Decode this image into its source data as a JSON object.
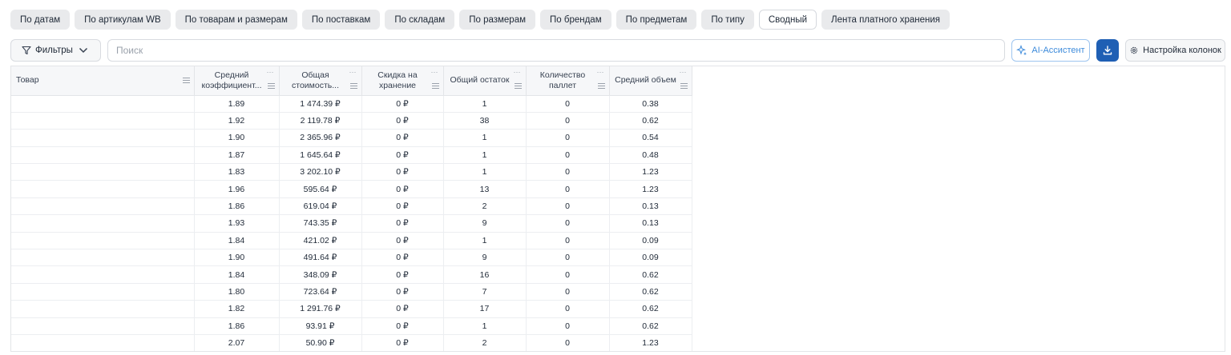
{
  "tabs": [
    {
      "label": "По датам",
      "active": false
    },
    {
      "label": "По артикулам WB",
      "active": false
    },
    {
      "label": "По товарам и размерам",
      "active": false
    },
    {
      "label": "По поставкам",
      "active": false
    },
    {
      "label": "По складам",
      "active": false
    },
    {
      "label": "По размерам",
      "active": false
    },
    {
      "label": "По брендам",
      "active": false
    },
    {
      "label": "По предметам",
      "active": false
    },
    {
      "label": "По типу",
      "active": false
    },
    {
      "label": "Сводный",
      "active": true
    },
    {
      "label": "Лента платного хранения",
      "active": false
    }
  ],
  "toolbar": {
    "filters_label": "Фильтры",
    "search_placeholder": "Поиск",
    "ai_label": "AI-Ассистент",
    "columns_label": "Настройка колонок"
  },
  "table": {
    "columns": [
      {
        "label": "Товар",
        "dots": ""
      },
      {
        "label": "Средний коэффициент...",
        "dots": "···"
      },
      {
        "label": "Общая стоимость...",
        "dots": "···"
      },
      {
        "label": "Скидка на хранение",
        "dots": "···"
      },
      {
        "label": "Общий остаток",
        "dots": "···"
      },
      {
        "label": "Количество паллет",
        "dots": "···"
      },
      {
        "label": "Средний объем",
        "dots": "···"
      }
    ],
    "rows": [
      [
        "",
        "1.89",
        "1 474.39 ₽",
        "0 ₽",
        "1",
        "0",
        "0.38"
      ],
      [
        "",
        "1.92",
        "2 119.78 ₽",
        "0 ₽",
        "38",
        "0",
        "0.62"
      ],
      [
        "",
        "1.90",
        "2 365.96 ₽",
        "0 ₽",
        "1",
        "0",
        "0.54"
      ],
      [
        "",
        "1.87",
        "1 645.64 ₽",
        "0 ₽",
        "1",
        "0",
        "0.48"
      ],
      [
        "",
        "1.83",
        "3 202.10 ₽",
        "0 ₽",
        "1",
        "0",
        "1.23"
      ],
      [
        "",
        "1.96",
        "595.64 ₽",
        "0 ₽",
        "13",
        "0",
        "1.23"
      ],
      [
        "",
        "1.86",
        "619.04 ₽",
        "0 ₽",
        "2",
        "0",
        "0.13"
      ],
      [
        "",
        "1.93",
        "743.35 ₽",
        "0 ₽",
        "9",
        "0",
        "0.13"
      ],
      [
        "",
        "1.84",
        "421.02 ₽",
        "0 ₽",
        "1",
        "0",
        "0.09"
      ],
      [
        "",
        "1.90",
        "491.64 ₽",
        "0 ₽",
        "9",
        "0",
        "0.09"
      ],
      [
        "",
        "1.84",
        "348.09 ₽",
        "0 ₽",
        "16",
        "0",
        "0.62"
      ],
      [
        "",
        "1.80",
        "723.64 ₽",
        "0 ₽",
        "7",
        "0",
        "0.62"
      ],
      [
        "",
        "1.82",
        "1 291.76 ₽",
        "0 ₽",
        "17",
        "0",
        "0.62"
      ],
      [
        "",
        "1.86",
        "93.91 ₽",
        "0 ₽",
        "1",
        "0",
        "0.62"
      ],
      [
        "",
        "2.07",
        "50.90 ₽",
        "0 ₽",
        "2",
        "0",
        "1.23"
      ]
    ]
  },
  "icons": {
    "filter": "funnel-icon",
    "chevron": "chevron-down-icon",
    "ai": "sparkle-icon",
    "download": "download-icon",
    "settings": "gear-icon"
  },
  "colors": {
    "accent": "#1f5fb4",
    "ai_accent": "#3d8bdb",
    "tab_bg": "#e9eaec"
  }
}
